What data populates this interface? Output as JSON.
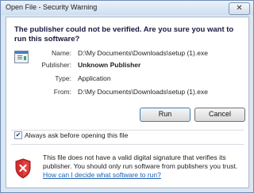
{
  "window": {
    "title": "Open File - Security Warning",
    "close_glyph": "✕"
  },
  "dialog": {
    "heading": "The publisher could not be verified.  Are you sure you want to run this software?",
    "fields": [
      {
        "label": "Name:",
        "value": "D:\\My Documents\\Downloads\\setup (1).exe",
        "bold": false
      },
      {
        "label": "Publisher:",
        "value": "Unknown Publisher",
        "bold": true
      },
      {
        "label": "Type:",
        "value": "Application",
        "bold": false
      },
      {
        "label": "From:",
        "value": "D:\\My Documents\\Downloads\\setup (1).exe",
        "bold": false
      }
    ],
    "buttons": {
      "run": "Run",
      "cancel": "Cancel"
    },
    "checkbox": {
      "label": "Always ask before opening this file",
      "checked": true,
      "glyph": "✔"
    },
    "warning": {
      "text": "This file does not have a valid digital signature that verifies its publisher.  You should only run software from publishers you trust.",
      "link": "How can I decide what software to run?"
    }
  },
  "icons": {
    "file": "application-file-icon",
    "shield": "security-shield-error-icon"
  },
  "colors": {
    "link": "#1a5fb4",
    "shield_red": "#d32f2f"
  }
}
